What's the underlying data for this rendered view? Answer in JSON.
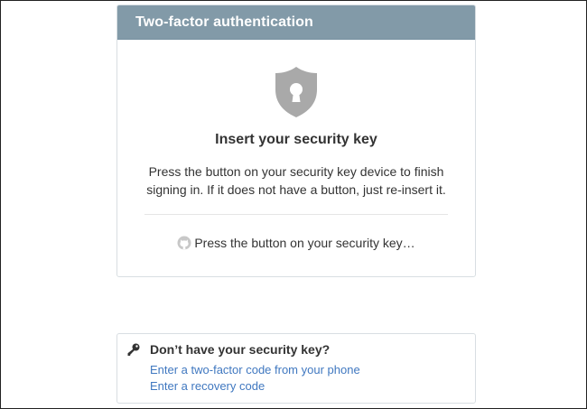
{
  "auth_card": {
    "header_title": "Two-factor authentication",
    "heading": "Insert your security key",
    "description": "Press the button on your security key device to finish signing in. If it does not have a button, just re-insert it.",
    "status_text": "Press the button on your security key…",
    "icons": {
      "shield": "shield-keyhole-icon",
      "status": "octocat-icon"
    }
  },
  "help": {
    "title": "Don’t have your security key?",
    "links": [
      {
        "label": "Enter a two-factor code from your phone"
      },
      {
        "label": "Enter a recovery code"
      }
    ],
    "icon": "key-icon"
  },
  "colors": {
    "header_bg": "#829aa8",
    "link": "#4078c0",
    "shield": "#a9a9a9",
    "text": "#333333",
    "border": "#d8dee2"
  }
}
